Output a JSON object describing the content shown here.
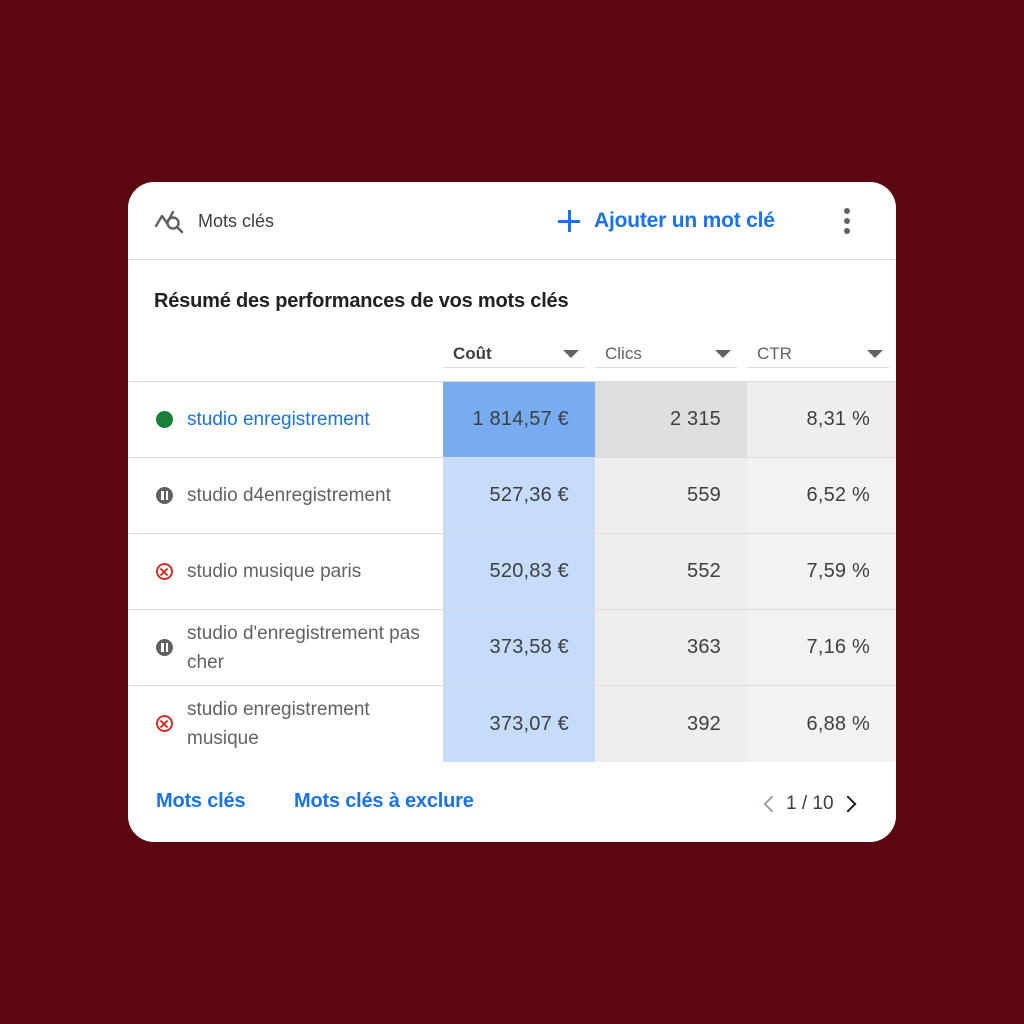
{
  "header": {
    "icon": "keyword-search-icon",
    "title": "Mots clés",
    "add_label": "Ajouter un mot clé",
    "more_icon": "more-vertical-icon"
  },
  "summary_title": "Résumé des performances de vos mots clés",
  "columns": [
    {
      "label": "Coût",
      "sorted": true
    },
    {
      "label": "Clics",
      "sorted": false
    },
    {
      "label": "CTR",
      "sorted": false
    }
  ],
  "rows": [
    {
      "status": "active",
      "keyword": "studio enregistrement",
      "cost": "1 814,57 €",
      "clicks": "2 315",
      "ctr": "8,31 %"
    },
    {
      "status": "paused",
      "keyword": "studio d4enregistrement",
      "cost": "527,36 €",
      "clicks": "559",
      "ctr": "6,52 %"
    },
    {
      "status": "removed",
      "keyword": "studio musique paris",
      "cost": "520,83 €",
      "clicks": "552",
      "ctr": "7,59 %"
    },
    {
      "status": "paused",
      "keyword": "studio d'enregistrement pas cher",
      "cost": "373,58 €",
      "clicks": "363",
      "ctr": "7,16 %"
    },
    {
      "status": "removed",
      "keyword": "studio enregistrement musique",
      "cost": "373,07 €",
      "clicks": "392",
      "ctr": "6,88 %"
    }
  ],
  "footer": {
    "link_keywords": "Mots clés",
    "link_negative": "Mots clés à exclure",
    "page": "1 / 10"
  },
  "colors": {
    "background": "#5b0611",
    "accent": "#1a73e8",
    "active_status": "#188038",
    "removed_status": "#d93025",
    "cost_highlight": "#78abf0",
    "cost_column": "#c6dcfa"
  }
}
